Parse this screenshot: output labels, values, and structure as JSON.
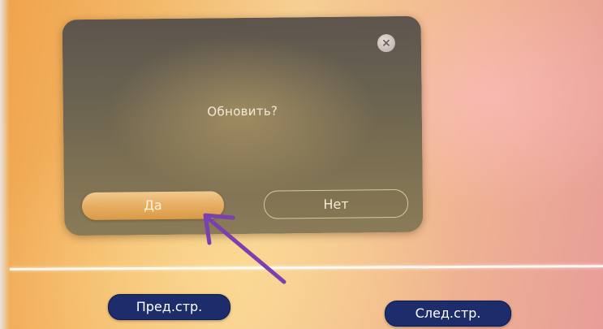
{
  "dialog": {
    "prompt": "Обновить?",
    "yes_label": "Да",
    "no_label": "Нет",
    "close_icon": "close-icon"
  },
  "footer": {
    "prev_label": "Пред.стр.",
    "next_label": "След.стр."
  },
  "annotation": {
    "arrow_color": "#7a3fb0",
    "points_to": "yes-button"
  },
  "colors": {
    "dialog_bg": "#6a6250",
    "yes_button": "#e8b066",
    "pill_bg": "#1d2d6b"
  }
}
